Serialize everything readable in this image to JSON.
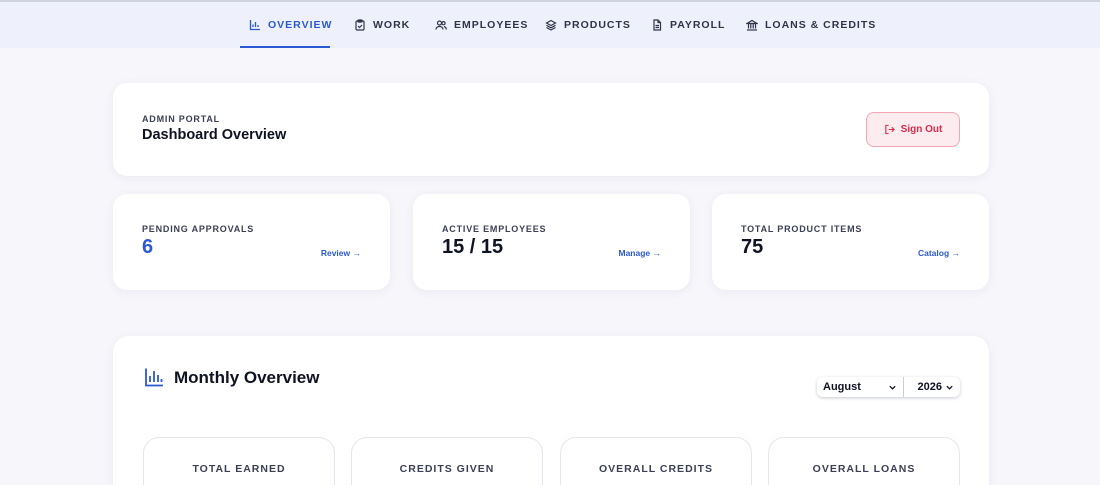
{
  "nav": {
    "items": [
      {
        "label": "OVERVIEW",
        "icon": "bar-chart-icon",
        "active": true
      },
      {
        "label": "WORK",
        "icon": "clipboard-icon",
        "active": false
      },
      {
        "label": "EMPLOYEES",
        "icon": "users-icon",
        "active": false
      },
      {
        "label": "PRODUCTS",
        "icon": "layers-icon",
        "active": false
      },
      {
        "label": "PAYROLL",
        "icon": "document-icon",
        "active": false
      },
      {
        "label": "LOANS & CREDITS",
        "icon": "bank-icon",
        "active": false
      }
    ],
    "accent_color": "#2b59d6"
  },
  "header": {
    "eyebrow": "ADMIN PORTAL",
    "title": "Dashboard Overview",
    "signout_label": "Sign Out",
    "signout_color": "#d92a4a"
  },
  "stats": [
    {
      "label": "PENDING APPROVALS",
      "value": "6",
      "link": "Review →"
    },
    {
      "label": "ACTIVE EMPLOYEES",
      "value": "15 / 15",
      "link": "Manage →"
    },
    {
      "label": "TOTAL PRODUCT ITEMS",
      "value": "75",
      "link": "Catalog →"
    }
  ],
  "overview": {
    "title": "Monthly Overview",
    "month": "August",
    "year": "2026",
    "metrics": [
      "TOTAL EARNED",
      "CREDITS GIVEN",
      "OVERALL CREDITS",
      "OVERALL LOANS"
    ]
  }
}
